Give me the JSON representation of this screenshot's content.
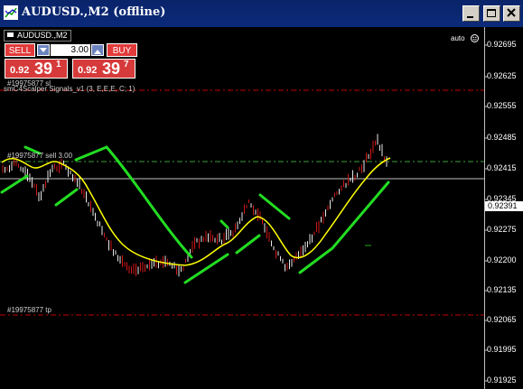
{
  "window": {
    "title": "AUDUSD.,M2 (offline)"
  },
  "chart": {
    "symbol_tab": "AUDUSD.,M2",
    "sell_label": "SELL",
    "buy_label": "BUY",
    "lot_value": "3.00",
    "sell_price": {
      "small": "0.92",
      "big": "39",
      "sup": "1"
    },
    "buy_price": {
      "small": "0.92",
      "big": "39",
      "sup": "7"
    },
    "sl_label": "#19975877 sl",
    "indicator_label": "smC4Scalper Signals_v1 (3, E,E,E, C; 1)",
    "order_label": "#19975877 sell 3.00",
    "tp_label": "#19975877 tp",
    "auto_label": "auto",
    "current_price": "0.92391",
    "y_axis": [
      "0.92695",
      "0.92625",
      "0.92555",
      "0.92485",
      "0.92415",
      "0.92345",
      "0.92275",
      "0.92200",
      "0.92135",
      "0.92065",
      "0.91995",
      "0.91925"
    ],
    "colors": {
      "background": "#000000",
      "bull_candle": "#d01818",
      "bear_candle": "#e8e8e8",
      "ma_line": "#ffff00",
      "signal_line": "#22dd22",
      "sl_tp_line": "#c00000",
      "order_line": "#32a032"
    }
  }
}
